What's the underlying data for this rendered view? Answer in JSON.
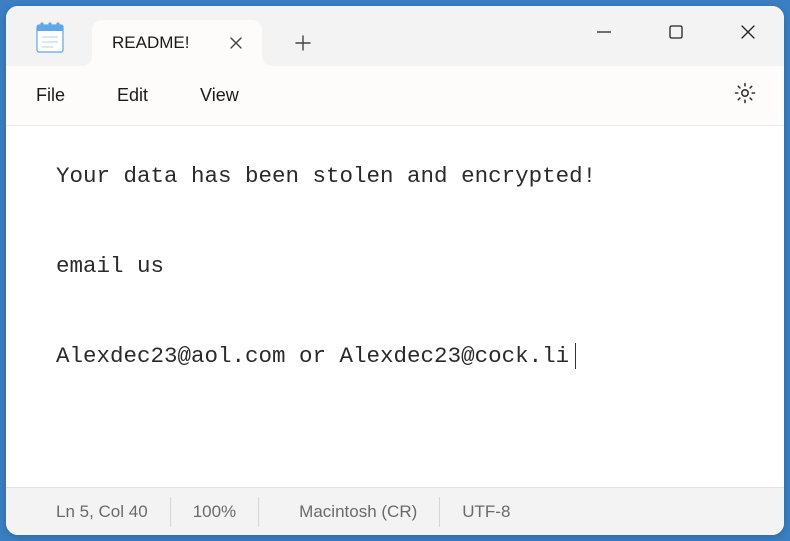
{
  "tab": {
    "title": "README!"
  },
  "menu": {
    "file": "File",
    "edit": "Edit",
    "view": "View"
  },
  "content": {
    "line1": "Your data has been stolen and encrypted!",
    "line2": "email us",
    "line3": "Alexdec23@aol.com or Alexdec23@cock.li"
  },
  "status": {
    "position": "Ln 5, Col 40",
    "zoom": "100%",
    "eol": "Macintosh (CR)",
    "encoding": "UTF-8"
  }
}
